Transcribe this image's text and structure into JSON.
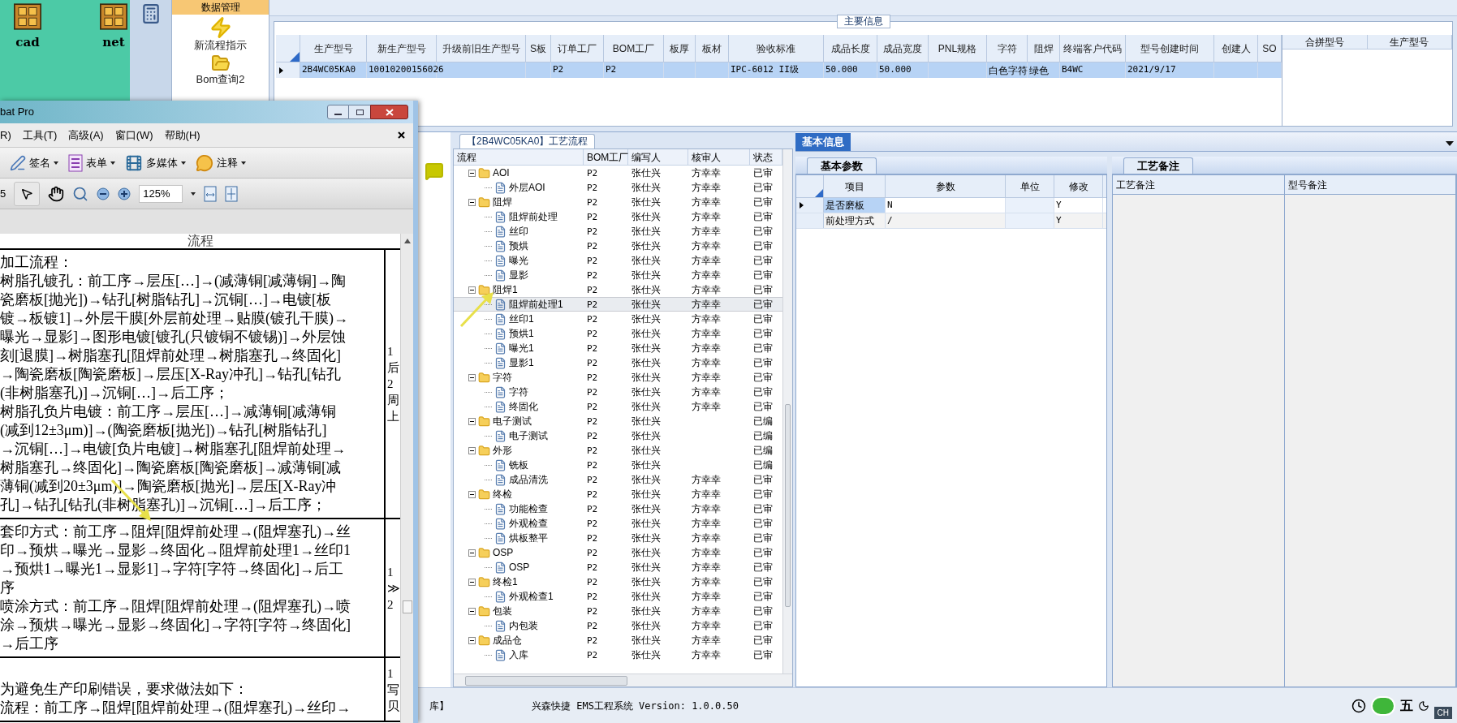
{
  "desktop": {
    "icons": [
      {
        "label": "cad"
      },
      {
        "label": "net"
      }
    ]
  },
  "nav": {
    "items": [
      {
        "label": "数据管理",
        "kind": "tab",
        "selected": true
      },
      {
        "label": "新流程指示",
        "kind": "bolt",
        "selected": false
      },
      {
        "label": "Bom查询2",
        "kind": "folder",
        "selected": false
      }
    ]
  },
  "main_info": {
    "title": "主要信息",
    "columns": [
      "生产型号",
      "新生产型号",
      "升级前旧生产型号",
      "S板",
      "订单工厂",
      "BOM工厂",
      "板厚",
      "板材",
      "验收标准",
      "成品长度",
      "成品宽度",
      "PNL规格",
      "字符",
      "阻焊",
      "终端客户代码",
      "型号创建时间",
      "创建人",
      "SO"
    ],
    "rows": [
      {
        "selected": true,
        "cells": [
          "2B4WC05KA0",
          "10010200156026",
          "",
          "",
          "P2",
          "P2",
          "",
          "",
          "IPC-6012 II级",
          "50.000",
          "50.000",
          "",
          "白色字符",
          "绿色",
          "B4WC",
          "2021/9/17",
          "",
          ""
        ]
      }
    ],
    "side_columns": [
      "合拼型号",
      "生产型号"
    ]
  },
  "flow": {
    "title": "【2B4WC05KA0】工艺流程",
    "columns": [
      "流程",
      "BOM工厂",
      "编写人",
      "核审人",
      "状态"
    ],
    "tree": [
      {
        "name": "AOI",
        "factory": "P2",
        "writer": "张仕兴",
        "reviewer": "方幸幸",
        "status": "已审",
        "expanded": true,
        "selected": false,
        "children": [
          {
            "name": "外层AOI",
            "factory": "P2",
            "writer": "张仕兴",
            "reviewer": "方幸幸",
            "status": "已审",
            "selected": false
          }
        ]
      },
      {
        "name": "阻焊",
        "factory": "P2",
        "writer": "张仕兴",
        "reviewer": "方幸幸",
        "status": "已审",
        "expanded": true,
        "selected": false,
        "children": [
          {
            "name": "阻焊前处理",
            "factory": "P2",
            "writer": "张仕兴",
            "reviewer": "方幸幸",
            "status": "已审",
            "selected": false
          },
          {
            "name": "丝印",
            "factory": "P2",
            "writer": "张仕兴",
            "reviewer": "方幸幸",
            "status": "已审",
            "selected": false
          },
          {
            "name": "预烘",
            "factory": "P2",
            "writer": "张仕兴",
            "reviewer": "方幸幸",
            "status": "已审",
            "selected": false
          },
          {
            "name": "曝光",
            "factory": "P2",
            "writer": "张仕兴",
            "reviewer": "方幸幸",
            "status": "已审",
            "selected": false
          },
          {
            "name": "显影",
            "factory": "P2",
            "writer": "张仕兴",
            "reviewer": "方幸幸",
            "status": "已审",
            "selected": false
          }
        ]
      },
      {
        "name": "阻焊1",
        "factory": "P2",
        "writer": "张仕兴",
        "reviewer": "方幸幸",
        "status": "已审",
        "expanded": true,
        "selected": false,
        "children": [
          {
            "name": "阻焊前处理1",
            "factory": "P2",
            "writer": "张仕兴",
            "reviewer": "方幸幸",
            "status": "已审",
            "selected": true
          },
          {
            "name": "丝印1",
            "factory": "P2",
            "writer": "张仕兴",
            "reviewer": "方幸幸",
            "status": "已审",
            "selected": false
          },
          {
            "name": "预烘1",
            "factory": "P2",
            "writer": "张仕兴",
            "reviewer": "方幸幸",
            "status": "已审",
            "selected": false
          },
          {
            "name": "曝光1",
            "factory": "P2",
            "writer": "张仕兴",
            "reviewer": "方幸幸",
            "status": "已审",
            "selected": false
          },
          {
            "name": "显影1",
            "factory": "P2",
            "writer": "张仕兴",
            "reviewer": "方幸幸",
            "status": "已审",
            "selected": false
          }
        ]
      },
      {
        "name": "字符",
        "factory": "P2",
        "writer": "张仕兴",
        "reviewer": "方幸幸",
        "status": "已审",
        "expanded": true,
        "selected": false,
        "children": [
          {
            "name": "字符",
            "factory": "P2",
            "writer": "张仕兴",
            "reviewer": "方幸幸",
            "status": "已审",
            "selected": false
          },
          {
            "name": "终固化",
            "factory": "P2",
            "writer": "张仕兴",
            "reviewer": "方幸幸",
            "status": "已审",
            "selected": false
          }
        ]
      },
      {
        "name": "电子测试",
        "factory": "P2",
        "writer": "张仕兴",
        "status": "已编",
        "expanded": true,
        "selected": false,
        "children": [
          {
            "name": "电子测试",
            "factory": "P2",
            "writer": "张仕兴",
            "status": "已编",
            "selected": false
          }
        ]
      },
      {
        "name": "外形",
        "factory": "P2",
        "writer": "张仕兴",
        "status": "已编",
        "expanded": true,
        "selected": false,
        "children": [
          {
            "name": "铣板",
            "factory": "P2",
            "writer": "张仕兴",
            "status": "已编",
            "selected": false
          },
          {
            "name": "成品清洗",
            "factory": "P2",
            "writer": "张仕兴",
            "reviewer": "方幸幸",
            "status": "已审",
            "selected": false
          }
        ]
      },
      {
        "name": "终检",
        "factory": "P2",
        "writer": "张仕兴",
        "reviewer": "方幸幸",
        "status": "已审",
        "expanded": true,
        "selected": false,
        "children": [
          {
            "name": "功能检查",
            "factory": "P2",
            "writer": "张仕兴",
            "reviewer": "方幸幸",
            "status": "已审",
            "selected": false
          },
          {
            "name": "外观检查",
            "factory": "P2",
            "writer": "张仕兴",
            "reviewer": "方幸幸",
            "status": "已审",
            "selected": false
          },
          {
            "name": "烘板整平",
            "factory": "P2",
            "writer": "张仕兴",
            "reviewer": "方幸幸",
            "status": "已审",
            "selected": false
          }
        ]
      },
      {
        "name": "OSP",
        "factory": "P2",
        "writer": "张仕兴",
        "reviewer": "方幸幸",
        "status": "已审",
        "expanded": true,
        "selected": false,
        "children": [
          {
            "name": "OSP",
            "factory": "P2",
            "writer": "张仕兴",
            "reviewer": "方幸幸",
            "status": "已审",
            "selected": false
          }
        ]
      },
      {
        "name": "终检1",
        "factory": "P2",
        "writer": "张仕兴",
        "reviewer": "方幸幸",
        "status": "已审",
        "expanded": true,
        "selected": false,
        "children": [
          {
            "name": "外观检查1",
            "factory": "P2",
            "writer": "张仕兴",
            "reviewer": "方幸幸",
            "status": "已审",
            "selected": false
          }
        ]
      },
      {
        "name": "包装",
        "factory": "P2",
        "writer": "张仕兴",
        "reviewer": "方幸幸",
        "status": "已审",
        "expanded": true,
        "selected": false,
        "children": [
          {
            "name": "内包装",
            "factory": "P2",
            "writer": "张仕兴",
            "reviewer": "方幸幸",
            "status": "已审",
            "selected": false
          }
        ]
      },
      {
        "name": "成品仓",
        "factory": "P2",
        "writer": "张仕兴",
        "reviewer": "方幸幸",
        "status": "已审",
        "expanded": true,
        "selected": false,
        "children": [
          {
            "name": "入库",
            "factory": "P2",
            "writer": "张仕兴",
            "reviewer": "方幸幸",
            "status": "已审",
            "selected": false
          }
        ]
      }
    ]
  },
  "info": {
    "tab": {
      "label": "基本信息",
      "selected": true
    },
    "params": {
      "tab": "基本参数",
      "columns": [
        "项目",
        "参数",
        "单位",
        "修改"
      ],
      "rows": [
        {
          "selected": true,
          "cells": [
            "是否磨板",
            "N",
            "",
            "Y"
          ]
        },
        {
          "selected": false,
          "cells": [
            "前处理方式",
            "/",
            "",
            "Y"
          ]
        }
      ]
    },
    "notes": {
      "tab": "工艺备注",
      "columns": [
        "工艺备注",
        "型号备注"
      ]
    }
  },
  "status_bar": {
    "left": "库】",
    "center": "兴森快捷 EMS工程系统 Version: 1.0.0.50",
    "tray": [
      "五",
      "CH"
    ]
  },
  "pdf": {
    "title": "bat Pro",
    "menu": [
      "R)",
      "工具(T)",
      "高级(A)",
      "窗口(W)",
      "帮助(H)"
    ],
    "tools": [
      {
        "label": "签名",
        "kind": "pen"
      },
      {
        "label": "表单",
        "kind": "form"
      },
      {
        "label": "多媒体",
        "kind": "media"
      },
      {
        "label": "注释",
        "kind": "comment"
      }
    ],
    "page_number": "5",
    "zoom": "125%",
    "doc_header": "流程",
    "cells": [
      {
        "lines": [
          "加工流程：",
          "树脂孔镀孔：前工序→层压[…]→(减薄铜[减薄铜]→陶",
          "瓷磨板[抛光])→钻孔[树脂钻孔]→沉铜[…]→电镀[板",
          "镀→板镀1]→外层干膜[外层前处理→贴膜(镀孔干膜)→",
          "曝光→显影]→图形电镀[镀孔(只镀铜不镀锡)]→外层蚀",
          "刻[退膜]→树脂塞孔[阻焊前处理→树脂塞孔→终固化]",
          "→陶瓷磨板[陶瓷磨板]→层压[X-Ray冲孔]→钻孔[钻孔",
          "(非树脂塞孔)]→沉铜[…]→后工序；",
          "树脂孔负片电镀：前工序→层压[…]→减薄铜[减薄铜",
          "(减到12±3μm)]→(陶瓷磨板[抛光])→钻孔[树脂钻孔]",
          "→沉铜[…]→电镀[负片电镀]→树脂塞孔[阻焊前处理→",
          "树脂塞孔→终固化]→陶瓷磨板[陶瓷磨板]→减薄铜[减",
          "薄铜(减到20±3μm)]→陶瓷磨板[抛光]→层压[X-Ray冲",
          "孔]→钻孔[钻孔(非树脂塞孔)]→沉铜[…]→后工序；"
        ],
        "side": [
          "1",
          "后",
          "2",
          "周",
          "上"
        ]
      },
      {
        "lines": [
          "套印方式：前工序→阻焊[阻焊前处理→(阻焊塞孔)→丝",
          "印→预烘→曝光→显影→终固化→阻焊前处理1→丝印1",
          "→预烘1→曝光1→显影1]→字符[字符→终固化]→后工",
          "序",
          "喷涂方式：前工序→阻焊[阻焊前处理→(阻焊塞孔)→喷",
          "涂→预烘→曝光→显影→终固化]→字符[字符→终固化]",
          "→后工序"
        ],
        "side": [
          "1",
          "≫",
          "2"
        ]
      },
      {
        "lines": [
          "为避免生产印刷错误，要求做法如下：",
          "流程：前工序→阻焊[阻焊前处理→(阻焊塞孔)→丝印→"
        ],
        "side": [
          "1",
          "写",
          "贝"
        ]
      }
    ]
  }
}
